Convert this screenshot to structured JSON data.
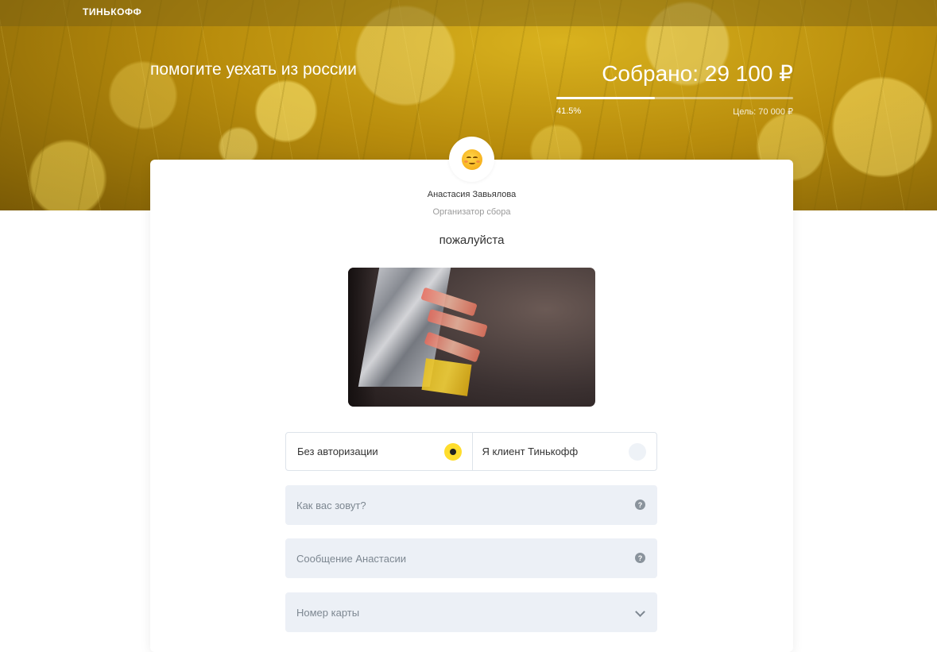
{
  "header": {
    "logo": "ТИНЬКОФФ"
  },
  "campaign": {
    "title": "помогите уехать из россии",
    "collected_label": "Собрано: 29 100 ₽",
    "progress_percent_text": "41.5%",
    "progress_fraction": 0.415,
    "goal_label": "Цель: 70 000 ₽"
  },
  "organizer": {
    "avatar_emoji_icon": "smiling-blush-face-icon",
    "name": "Анастасия Завьялова",
    "role": "Организатор сбора"
  },
  "description": "пожалуйста",
  "payment_mode": {
    "options": [
      {
        "label": "Без авторизации",
        "selected": true
      },
      {
        "label": "Я клиент Тинькофф",
        "selected": false
      }
    ]
  },
  "form": {
    "name_placeholder": "Как вас зовут?",
    "message_placeholder": "Сообщение Анастасии",
    "card_placeholder": "Номер карты"
  },
  "colors": {
    "accent": "#ffdd2d",
    "field_bg": "#ecf0f6"
  }
}
